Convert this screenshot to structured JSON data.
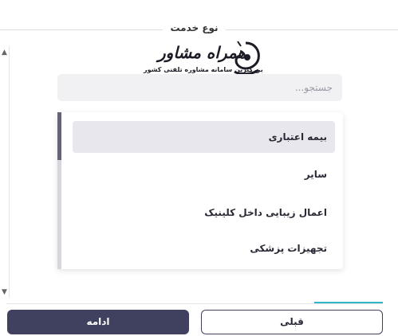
{
  "section": {
    "legend": "نوع خدمت"
  },
  "logo": {
    "title": "همراه مشاور",
    "subtitle": "بزرگترین سامانه مشاوره تلفنی کشور"
  },
  "search": {
    "placeholder": "جستجو..."
  },
  "dropdown": {
    "options": [
      {
        "label": "بیمه اعتباری",
        "selected": true
      },
      {
        "label": "سایر",
        "selected": false
      },
      {
        "label": "اعمال زیبایی داخل کلینیک",
        "selected": false
      },
      {
        "label": "تجهیزات پزشکی",
        "selected": false
      }
    ]
  },
  "buttons": {
    "continue": "ادامه",
    "previous": "قبلی"
  },
  "icons": {
    "scroll_up": "chevron-up-icon",
    "scroll_down": "chevron-down-icon"
  },
  "colors": {
    "primary": "#40405f",
    "accent": "#2fb7c8",
    "selected_bg": "#e7e7ed"
  }
}
